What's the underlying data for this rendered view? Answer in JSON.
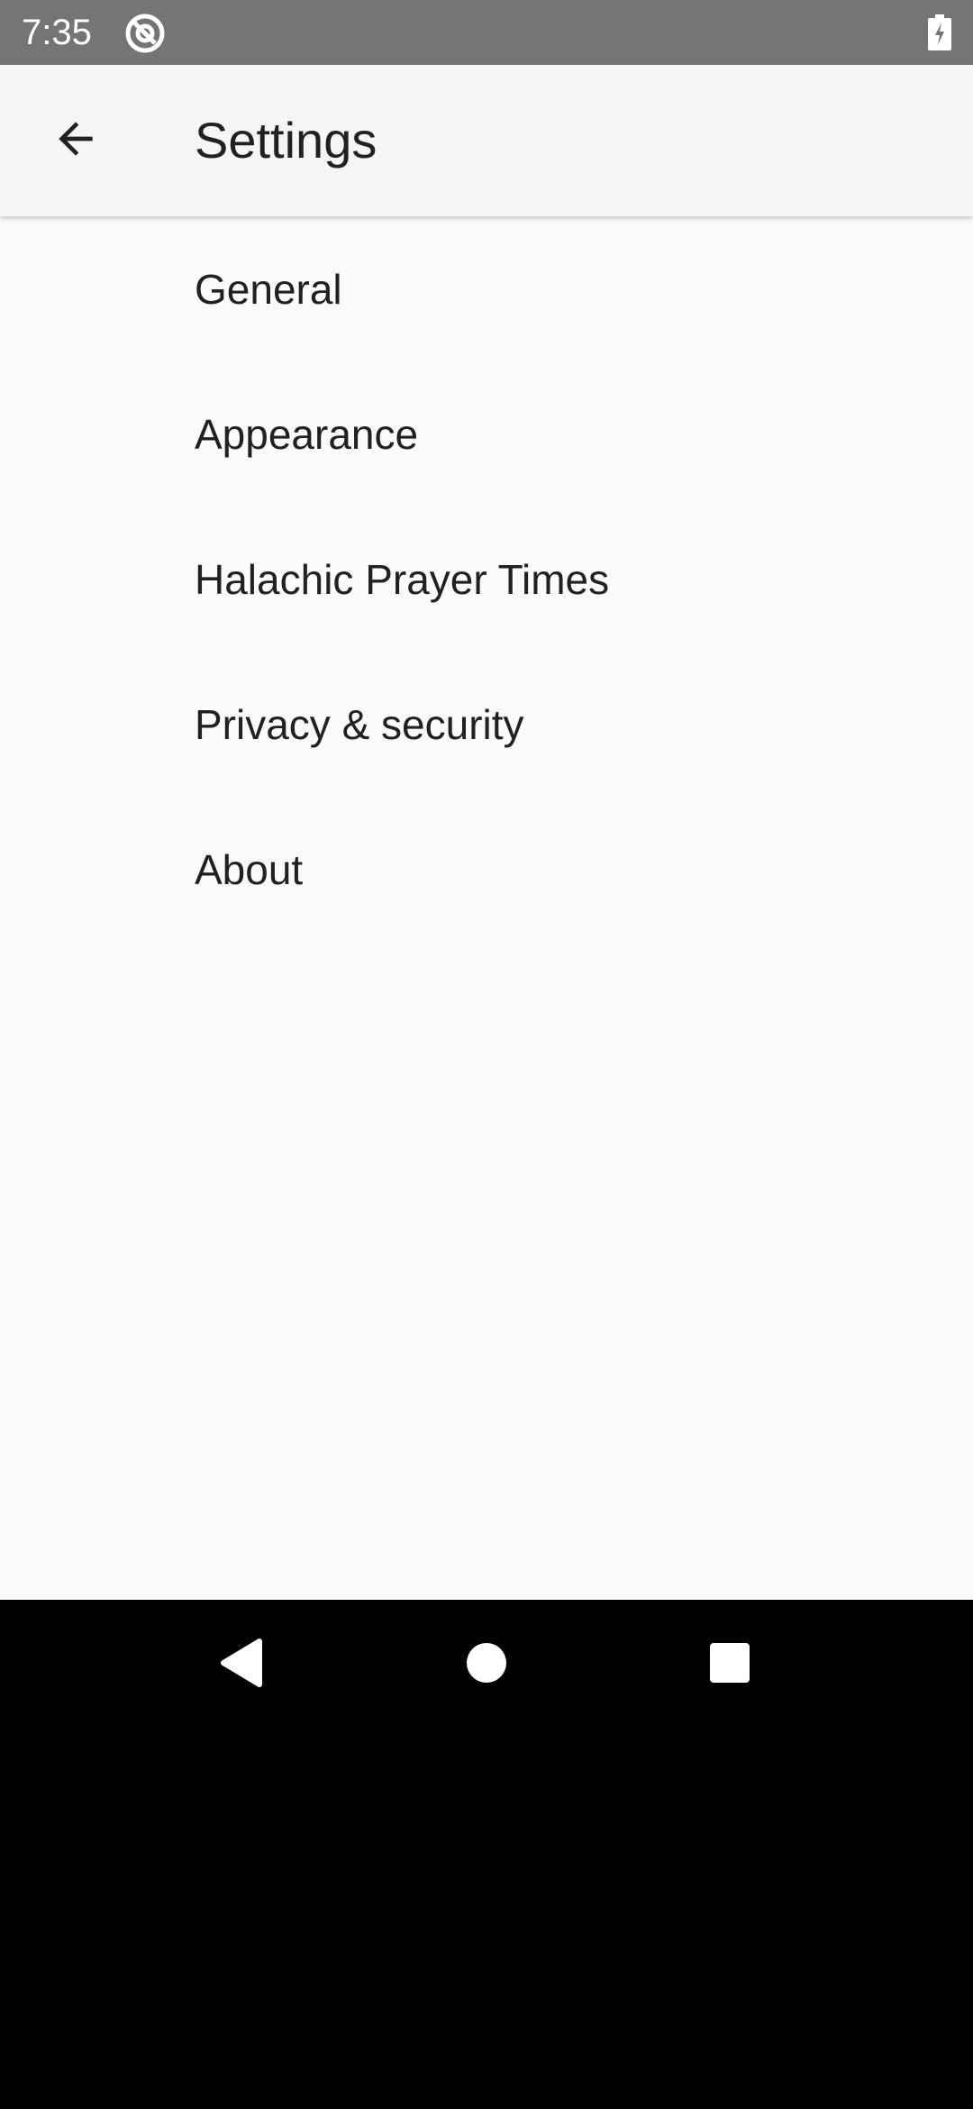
{
  "status_bar": {
    "time": "7:35",
    "app_icon": "at-sign-circle-icon",
    "battery_icon": "battery-charging-icon"
  },
  "app_bar": {
    "title": "Settings",
    "back_icon": "arrow-back-icon"
  },
  "settings": {
    "items": [
      {
        "label": "General"
      },
      {
        "label": "Appearance"
      },
      {
        "label": "Halachic Prayer Times"
      },
      {
        "label": "Privacy & security"
      },
      {
        "label": "About"
      }
    ]
  },
  "nav_bar": {
    "back_icon": "nav-back-triangle-icon",
    "home_icon": "nav-home-circle-icon",
    "recents_icon": "nav-recents-square-icon"
  },
  "colors": {
    "status_bar": "#757575",
    "app_bar": "#f5f5f5",
    "background": "#fafafa",
    "text_primary": "#212121",
    "nav_bar": "#000000"
  }
}
